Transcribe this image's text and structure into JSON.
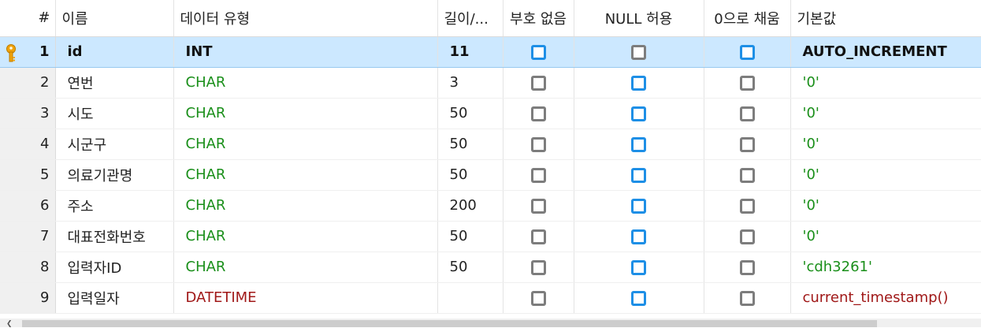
{
  "columns": {
    "num": "#",
    "name": "이름",
    "type": "데이터 유형",
    "length": "길이/...",
    "unsigned": "부호 없음",
    "nullable": "NULL 허용",
    "zerofill": "0으로 채움",
    "default": "기본값"
  },
  "rows": [
    {
      "num": "1",
      "name": "id",
      "type": "INT",
      "length": "11",
      "unsigned": true,
      "nullable": false,
      "zerofill": true,
      "default": "AUTO_INCREMENT",
      "primary_key": true
    },
    {
      "num": "2",
      "name": "연번",
      "type": "CHAR",
      "length": "3",
      "unsigned": false,
      "nullable": true,
      "zerofill": false,
      "default": "'0'"
    },
    {
      "num": "3",
      "name": "시도",
      "type": "CHAR",
      "length": "50",
      "unsigned": false,
      "nullable": true,
      "zerofill": false,
      "default": "'0'"
    },
    {
      "num": "4",
      "name": "시군구",
      "type": "CHAR",
      "length": "50",
      "unsigned": false,
      "nullable": true,
      "zerofill": false,
      "default": "'0'"
    },
    {
      "num": "5",
      "name": "의료기관명",
      "type": "CHAR",
      "length": "50",
      "unsigned": false,
      "nullable": true,
      "zerofill": false,
      "default": "'0'"
    },
    {
      "num": "6",
      "name": "주소",
      "type": "CHAR",
      "length": "200",
      "unsigned": false,
      "nullable": true,
      "zerofill": false,
      "default": "'0'"
    },
    {
      "num": "7",
      "name": "대표전화번호",
      "type": "CHAR",
      "length": "50",
      "unsigned": false,
      "nullable": true,
      "zerofill": false,
      "default": "'0'"
    },
    {
      "num": "8",
      "name": "입력자ID",
      "type": "CHAR",
      "length": "50",
      "unsigned": false,
      "nullable": true,
      "zerofill": false,
      "default": "'cdh3261'"
    },
    {
      "num": "9",
      "name": "입력일자",
      "type": "DATETIME",
      "length": "",
      "unsigned": false,
      "nullable": true,
      "zerofill": false,
      "default": "current_timestamp()"
    }
  ],
  "colors": {
    "selected_row": "#cce8ff",
    "type_char": "#1a8f1a",
    "type_datetime": "#a01818",
    "checkbox_checked": "#1e8fe6",
    "checkbox_unchecked": "#7d7d7d",
    "key_icon": "#f0a30a"
  },
  "icons": {
    "primary_key": "key-icon",
    "scroll_left": "arrow-left-icon"
  }
}
